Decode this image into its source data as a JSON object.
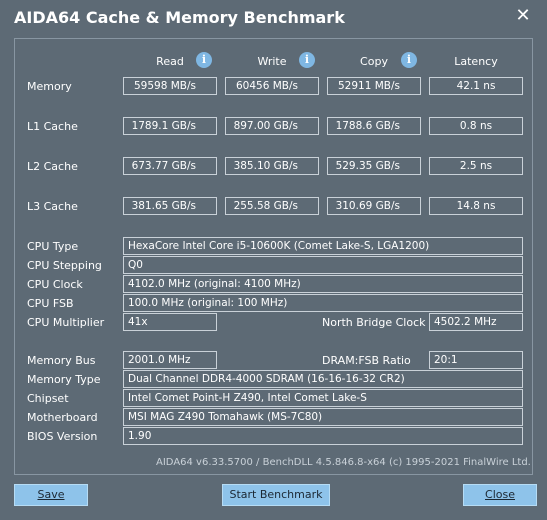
{
  "window": {
    "title": "AIDA64 Cache & Memory Benchmark",
    "close_glyph": "✕"
  },
  "columns": {
    "read": "Read",
    "write": "Write",
    "copy": "Copy",
    "latency": "Latency",
    "info_glyph": "i"
  },
  "rows": {
    "memory": {
      "label": "Memory",
      "read": "59598 MB/s",
      "write": "60456 MB/s",
      "copy": "52911 MB/s",
      "latency": "42.1 ns"
    },
    "l1": {
      "label": "L1 Cache",
      "read": "1789.1 GB/s",
      "write": "897.00 GB/s",
      "copy": "1788.6 GB/s",
      "latency": "0.8 ns"
    },
    "l2": {
      "label": "L2 Cache",
      "read": "673.77 GB/s",
      "write": "385.10 GB/s",
      "copy": "529.35 GB/s",
      "latency": "2.5 ns"
    },
    "l3": {
      "label": "L3 Cache",
      "read": "381.65 GB/s",
      "write": "255.58 GB/s",
      "copy": "310.69 GB/s",
      "latency": "14.8 ns"
    }
  },
  "cpu": {
    "type_label": "CPU Type",
    "type_value": "HexaCore Intel Core i5-10600K  (Comet Lake-S, LGA1200)",
    "stepping_label": "CPU Stepping",
    "stepping_value": "Q0",
    "clock_label": "CPU Clock",
    "clock_value": "4102.0 MHz  (original: 4100 MHz)",
    "fsb_label": "CPU FSB",
    "fsb_value": "100.0 MHz  (original: 100 MHz)",
    "multiplier_label": "CPU Multiplier",
    "multiplier_value": "41x",
    "nb_clock_label": "North Bridge Clock",
    "nb_clock_value": "4502.2 MHz"
  },
  "memory_info": {
    "bus_label": "Memory Bus",
    "bus_value": "2001.0 MHz",
    "ratio_label": "DRAM:FSB Ratio",
    "ratio_value": "20:1",
    "type_label": "Memory Type",
    "type_value": "Dual Channel DDR4-4000 SDRAM  (16-16-16-32 CR2)",
    "chipset_label": "Chipset",
    "chipset_value": "Intel Comet Point-H Z490, Intel Comet Lake-S",
    "motherboard_label": "Motherboard",
    "motherboard_value": "MSI MAG Z490 Tomahawk (MS-7C80)",
    "bios_label": "BIOS Version",
    "bios_value": "1.90"
  },
  "footer": {
    "version_text": "AIDA64 v6.33.5700 / BenchDLL 4.5.846.8-x64  (c) 1995-2021 FinalWire Ltd."
  },
  "buttons": {
    "save": "Save",
    "start": "Start Benchmark",
    "close": "Close"
  }
}
